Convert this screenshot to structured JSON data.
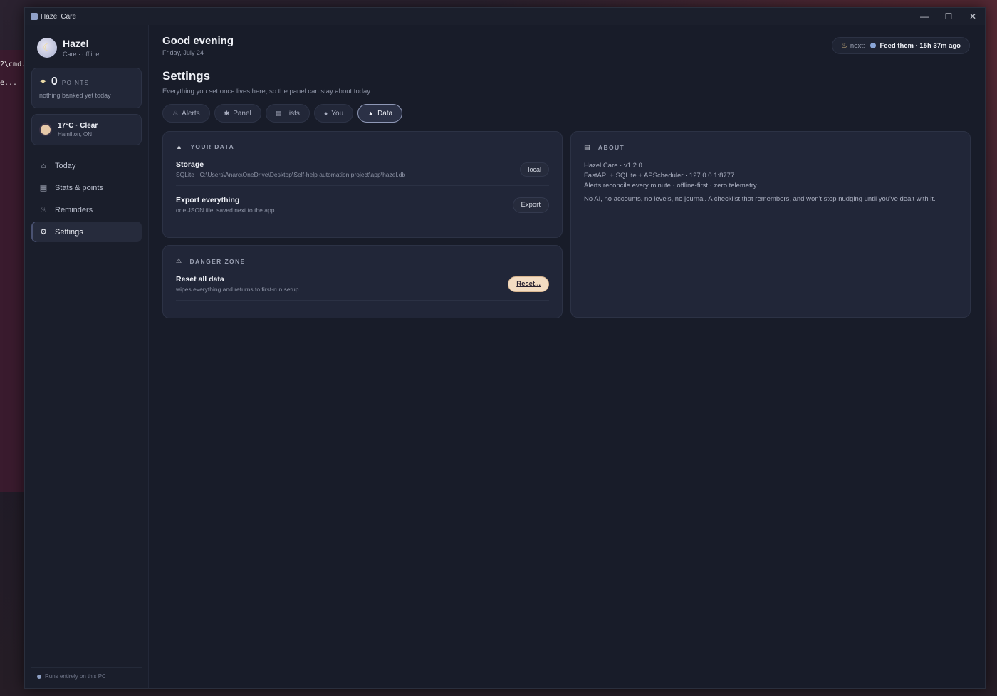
{
  "behind": {
    "lines": [
      "2\\cmd.",
      "e..."
    ]
  },
  "window": {
    "title": "Hazel Care"
  },
  "profile": {
    "name": "Hazel",
    "status": "Care · offline"
  },
  "points": {
    "value": "0",
    "label": "POINTS",
    "sub": "nothing banked yet today"
  },
  "weather": {
    "main": "17°C · Clear",
    "location": "Hamilton, ON"
  },
  "nav": [
    {
      "label": "Today",
      "icon": "house-icon"
    },
    {
      "label": "Stats & points",
      "icon": "chart-icon"
    },
    {
      "label": "Reminders",
      "icon": "bell-icon"
    },
    {
      "label": "Settings",
      "icon": "gear-icon",
      "active": true
    }
  ],
  "footer": {
    "text": "Runs entirely on this PC"
  },
  "header": {
    "greeting": "Good evening",
    "date": "Friday, July 24",
    "next_label": "next:",
    "next_value": "Feed them · 15h 37m ago"
  },
  "settings": {
    "title": "Settings",
    "subtitle": "Everything you set once lives here, so the panel can stay about today.",
    "tabs": [
      {
        "label": "Alerts",
        "icon": "bell-icon"
      },
      {
        "label": "Panel",
        "icon": "asterisk-icon"
      },
      {
        "label": "Lists",
        "icon": "list-icon"
      },
      {
        "label": "You",
        "icon": "user-icon"
      },
      {
        "label": "Data",
        "icon": "lock-icon",
        "active": true
      }
    ]
  },
  "your_data": {
    "heading": "YOUR DATA",
    "storage_title": "Storage",
    "storage_sub": "SQLite · C:\\Users\\Anarc\\OneDrive\\Desktop\\Self-help automation project\\app\\hazel.db",
    "storage_chip": "local",
    "export_title": "Export everything",
    "export_sub": "one JSON file, saved next to the app",
    "export_button": "Export"
  },
  "danger": {
    "heading": "DANGER ZONE",
    "reset_title": "Reset all data",
    "reset_sub": "wipes everything and returns to first-run setup",
    "reset_button": "Reset..."
  },
  "about": {
    "heading": "ABOUT",
    "lines": [
      "Hazel Care · v1.2.0",
      "FastAPI + SQLite + APScheduler · 127.0.0.1:8777",
      "Alerts reconcile every minute · offline-first · zero telemetry"
    ],
    "note": "No AI, no accounts, no levels, no journal. A checklist that remembers, and won't stop nudging until you've dealt with it."
  }
}
